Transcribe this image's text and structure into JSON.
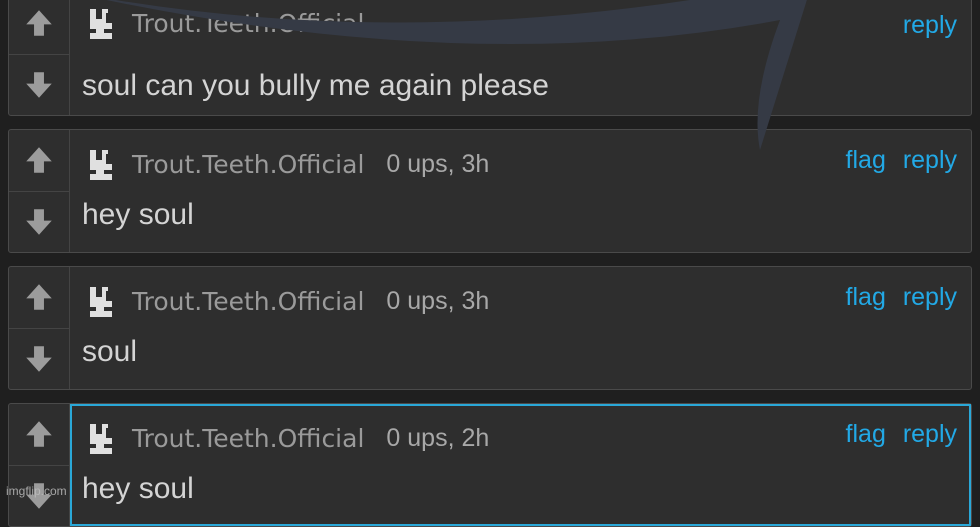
{
  "actions": {
    "flag": "flag",
    "reply": "reply"
  },
  "comments": [
    {
      "username": "Trout.Teeth.Official",
      "ups": "",
      "text": "soul can you bully me again please",
      "reply_label": "reply"
    },
    {
      "username": "Trout.Teeth.Official",
      "ups": "0 ups, 3h",
      "text": "hey soul"
    },
    {
      "username": "Trout.Teeth.Official",
      "ups": "0 ups, 3h",
      "text": "soul"
    },
    {
      "username": "Trout.Teeth.Official",
      "ups": "0 ups, 2h",
      "text": "hey soul"
    }
  ],
  "watermark": "imgflip.com",
  "colors": {
    "link": "#22a9e6",
    "highlight": "#2aa8d8",
    "panel": "#2e2e2e",
    "background": "#1f1f1f"
  }
}
